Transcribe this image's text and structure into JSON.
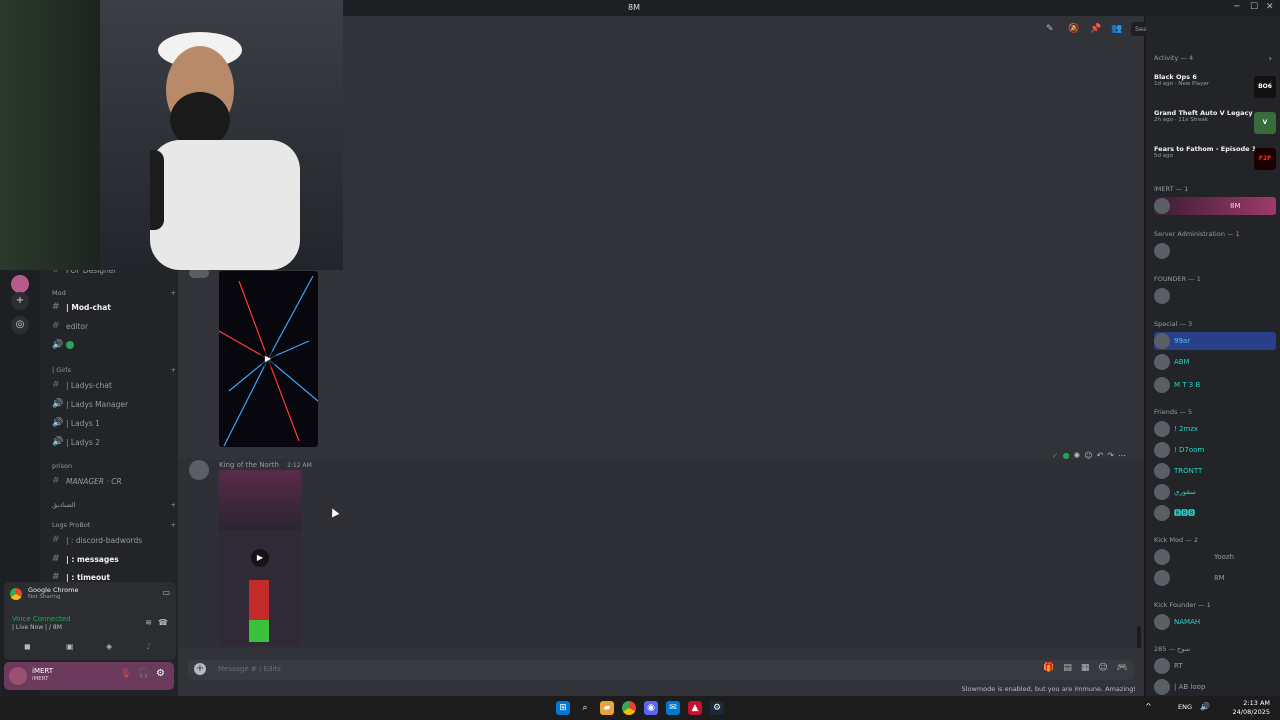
{
  "window": {
    "title": "8M"
  },
  "search": {
    "placeholder": "Search"
  },
  "channels": {
    "partial_top": "FOF Designer",
    "categories": [
      {
        "name": "Mod",
        "channels": [
          {
            "label": "| Mod-chat",
            "bold": true
          },
          {
            "label": "editor"
          }
        ]
      },
      {
        "name": "| Girls",
        "channels": [
          {
            "label": "| Ladys-chat"
          },
          {
            "label": "| Ladys Manager"
          },
          {
            "label": "| Ladys 1"
          },
          {
            "label": "| Ladys 2"
          }
        ]
      },
      {
        "name": "prison",
        "channels": [
          {
            "label": "MANAGER · CR"
          }
        ]
      },
      {
        "name": "الصناديق",
        "channels": []
      },
      {
        "name": "Logs ProBot",
        "channels": [
          {
            "label": "| : discord-badwords"
          },
          {
            "label": "| : messages",
            "bold": true
          },
          {
            "label": "| : timeout",
            "bold": true
          }
        ]
      }
    ]
  },
  "voice": {
    "app": "Google Chrome",
    "app_status": "Not Sharing",
    "status": "Voice Connected",
    "channel": "| Live Now | / 8M"
  },
  "user": {
    "name": "iMERT",
    "status": "iMERT"
  },
  "message": {
    "author": "King of the North",
    "time": "2:12 AM"
  },
  "composer": {
    "placeholder": "Message # | Edits"
  },
  "slowmode": "Slowmode is enabled, but you are immune. Amazing!",
  "members": {
    "activity_header": "Activity — 4",
    "activities": [
      {
        "game": "Black Ops 6",
        "sub": "1d ago · New Player",
        "thumb": "BO6",
        "thumb_color": "#111111",
        "thumb_text_color": "#ffffff"
      },
      {
        "game": "Grand Theft Auto V Legacy",
        "sub": "2h ago · 11x Streak",
        "thumb": "V",
        "thumb_color": "#3a6b3a",
        "thumb_text_color": "#ffffff"
      },
      {
        "game": "Fears to Fathom - Episode 1",
        "sub": "5d ago",
        "thumb": "F2F",
        "thumb_color": "#1a0000",
        "thumb_text_color": "#ff2a2a"
      }
    ],
    "sections": [
      {
        "header": "iMERT — 1",
        "members": [
          {
            "name": "8M",
            "color": "#f2f3f5"
          }
        ]
      },
      {
        "header": "Server Administration — 1",
        "members": [
          {
            "name": "",
            "color": "#949ba4"
          }
        ]
      },
      {
        "header": "FOUNDER — 1",
        "members": [
          {
            "name": "",
            "color": "#949ba4"
          }
        ]
      },
      {
        "header": "Special — 3",
        "members": [
          {
            "name": "99ar",
            "color": "#4dc4ff"
          },
          {
            "name": "ABM",
            "color": "#23d5c8"
          },
          {
            "name": "M T 3 B",
            "color": "#23d5c8"
          }
        ]
      },
      {
        "header": "Friends — 5",
        "members": [
          {
            "name": "! 2mzx",
            "color": "#23d5c8"
          },
          {
            "name": "! D7oom",
            "color": "#23d5c8"
          },
          {
            "name": "TRONTT",
            "color": "#23d5c8"
          },
          {
            "name": "سقوري",
            "color": "#23d5c8"
          },
          {
            "name": "🅱🅱🅱",
            "color": "#23d5c8"
          }
        ]
      },
      {
        "header": "Kick Mod — 2",
        "members": [
          {
            "name": "Yoozh",
            "color": "#949ba4"
          },
          {
            "name": "8M",
            "color": "#949ba4"
          }
        ]
      },
      {
        "header": "Kick Founder — 1",
        "members": [
          {
            "name": "NAMAH",
            "color": "#23d5c8"
          }
        ]
      },
      {
        "header": "سوح — 285",
        "members": [
          {
            "name": "RT",
            "color": "#949ba4"
          },
          {
            "name": "| AB loop",
            "color": "#949ba4"
          }
        ]
      }
    ]
  },
  "taskbar": {
    "lang": "ENG",
    "time": "2:13 AM",
    "date": "24/08/2025"
  },
  "colors": {
    "accent": "#5865f2",
    "online": "#23a55a",
    "teal": "#23d5c8"
  }
}
